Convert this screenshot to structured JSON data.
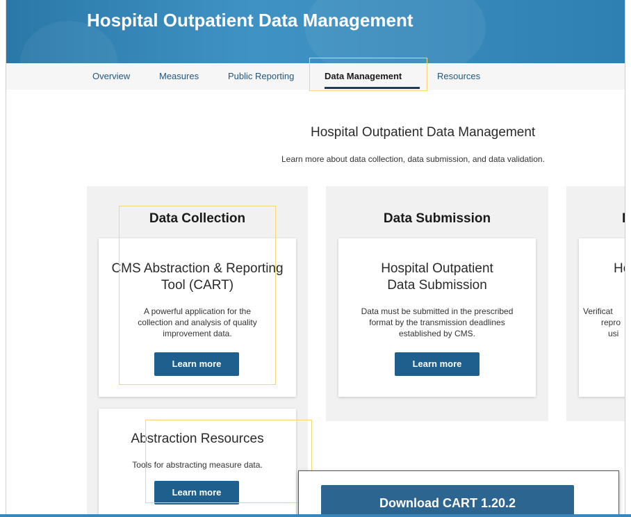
{
  "header": {
    "title": "Hospital Outpatient Data Management"
  },
  "nav": {
    "tabs": [
      {
        "label": "Overview"
      },
      {
        "label": "Measures"
      },
      {
        "label": "Public Reporting"
      },
      {
        "label": "Data Management"
      },
      {
        "label": "Resources"
      }
    ],
    "active_tab": "Data Management"
  },
  "main": {
    "title": "Hospital Outpatient Data Management",
    "subtitle": "Learn more about data collection, data submission, and data validation.",
    "columns": [
      {
        "heading": "Data Collection",
        "cards": [
          {
            "title": "CMS Abstraction & Reporting Tool (CART)",
            "description": "A powerful application for the collection and analysis of quality improvement data.",
            "button": "Learn more"
          },
          {
            "title": "Abstraction Resources",
            "description": "Tools for abstracting measure data.",
            "button": "Learn more"
          }
        ]
      },
      {
        "heading": "Data Submission",
        "cards": [
          {
            "title": "Hospital Outpatient Data Submission",
            "description": "Data must be submitted in the prescribed format by the transmission deadlines established by CMS.",
            "button": "Learn more"
          }
        ]
      },
      {
        "heading": "D",
        "cards": [
          {
            "title": "Ho",
            "description_lines": [
              "Verificat",
              "repro",
              "usi"
            ]
          }
        ]
      }
    ]
  },
  "download": {
    "label": "Download CART 1.20.2"
  },
  "colors": {
    "accent": "#1f5f8d",
    "banner": "#3889bb",
    "highlight": "#f7d774"
  }
}
